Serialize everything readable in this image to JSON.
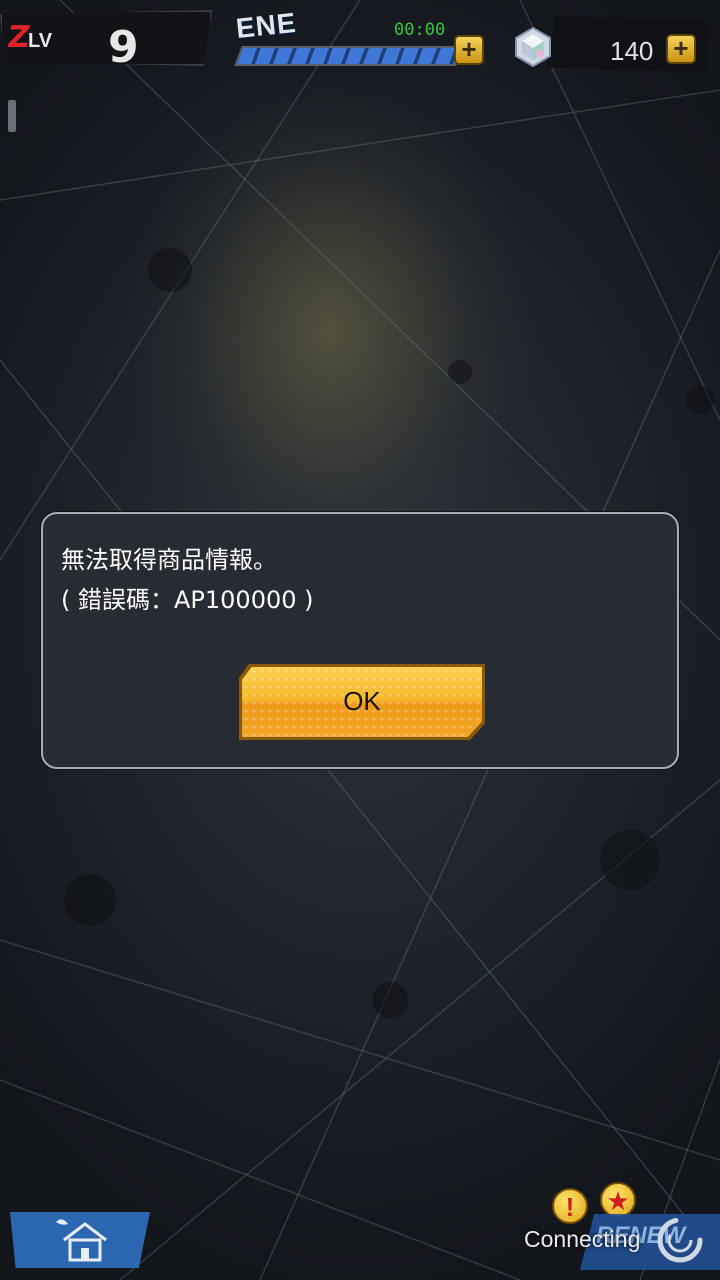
{
  "hud": {
    "lv_label": "LV",
    "level": "9",
    "ene_label": "ENE",
    "ene_timer": "00:00",
    "ene_fill": 1.0,
    "gem_count": "140",
    "plus_label": "+"
  },
  "dialog": {
    "line1": "無法取得商品情報。",
    "line2": "( 錯誤碼：AP100000 )",
    "ok_label": "OK"
  },
  "footer": {
    "connecting": "Connecting",
    "renew_label": "RENEW"
  },
  "colors": {
    "accent_gold": "#f6b72b",
    "ene_bar": "#3f78d6",
    "timer_green": "#34c838",
    "lv_red": "#e0232a"
  },
  "icons": {
    "home": "home-icon",
    "gem": "gem-icon",
    "spinner": "loading-spinner-icon",
    "alert": "alert-badge-icon"
  }
}
